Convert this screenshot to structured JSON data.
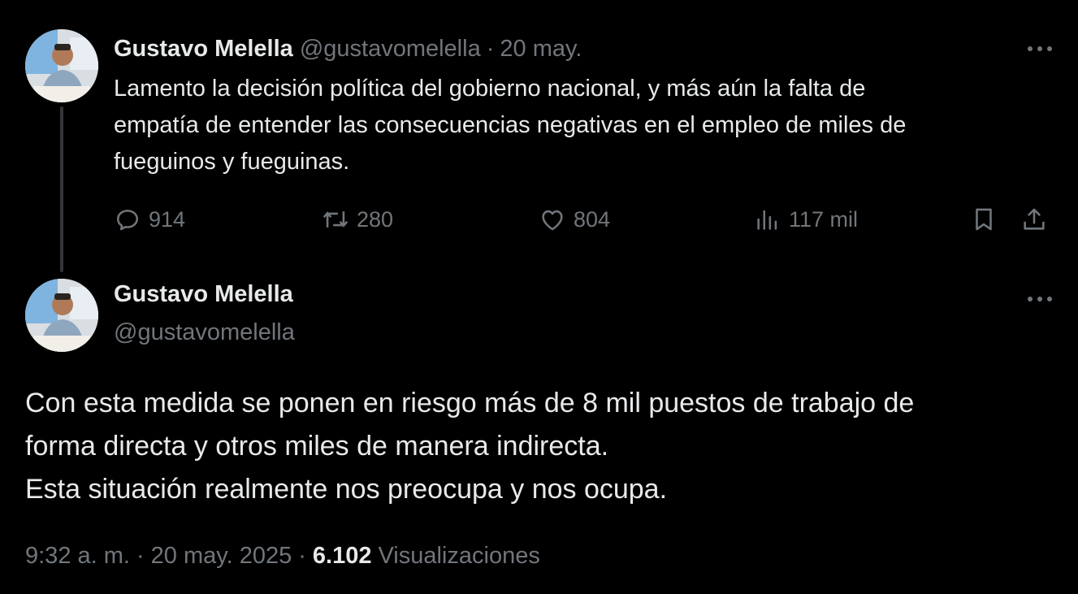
{
  "parent_tweet": {
    "author_name": "Gustavo Melella",
    "handle": "@gustavomelella",
    "separator": "·",
    "date": "20 may.",
    "text": "Lamento la decisión política del gobierno nacional, y más aún la falta de\nempatía de entender las consecuencias negativas en el empleo de miles de\nfueguinos y fueguinas.",
    "replies": "914",
    "retweets": "280",
    "likes": "804",
    "views": "117 mil"
  },
  "main_tweet": {
    "author_name": "Gustavo Melella",
    "handle": "@gustavomelella",
    "text_lines": [
      "Con esta medida se ponen en riesgo más de 8 mil puestos de trabajo de",
      "forma directa y otros miles de manera indirecta.",
      "Esta situación realmente nos preocupa y nos ocupa."
    ],
    "time": "9:32 a. m.",
    "separator": "·",
    "full_date": "20 may. 2025",
    "views_count": "6.102",
    "views_label": "Visualizaciones"
  },
  "colors": {
    "background": "#000000",
    "primary_text": "#e7e9ea",
    "secondary_text": "#71767b",
    "thread_line": "#333639"
  },
  "icons": [
    "more-icon",
    "reply-icon",
    "retweet-icon",
    "like-icon",
    "views-icon",
    "bookmark-icon",
    "share-icon"
  ]
}
